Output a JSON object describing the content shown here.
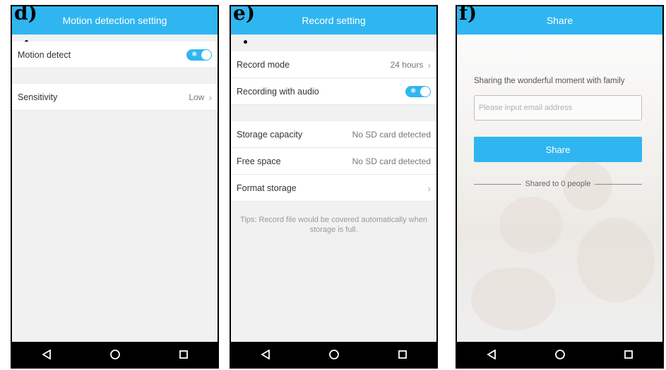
{
  "panels": {
    "d": {
      "label": "d)",
      "title": "Motion detection setting",
      "rows": [
        {
          "label": "Motion detect"
        },
        {
          "label": "Sensitivity",
          "value": "Low"
        }
      ]
    },
    "e": {
      "label": "e)",
      "title": "Record setting",
      "rows": [
        {
          "label": "Record mode",
          "value": "24 hours"
        },
        {
          "label": "Recording with audio"
        },
        {
          "label": "Storage capacity",
          "value": "No SD card detected"
        },
        {
          "label": "Free space",
          "value": "No SD card detected"
        },
        {
          "label": "Format storage"
        }
      ],
      "tips": "Tips: Record file would be covered automatically when storage is full."
    },
    "f": {
      "label": "f)",
      "title": "Share",
      "prompt": "Sharing the wonderful moment with family",
      "email_placeholder": "Please input email address",
      "share_button": "Share",
      "shared_count": "Shared to 0 people"
    }
  },
  "colors": {
    "accent": "#2fb6f0",
    "navbar": "#000000"
  },
  "icons": [
    "back-triangle-icon",
    "home-circle-icon",
    "recents-square-icon",
    "chevron-right-icon"
  ]
}
